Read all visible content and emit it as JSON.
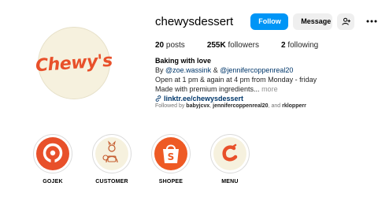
{
  "profile": {
    "username": "chewysdessert",
    "avatar_logo_text": "Chewy's"
  },
  "actions": {
    "follow_label": "Follow",
    "message_label": "Message",
    "suggest_icon": "add-user-icon",
    "more_icon": "more-icon"
  },
  "stats": {
    "posts_count": "20",
    "posts_label": "posts",
    "followers_count": "255K",
    "followers_label": "followers",
    "following_count": "2",
    "following_label": "following"
  },
  "bio": {
    "name": "Baking with love",
    "by_prefix": "By ",
    "mention_1": "@zoe.wassink",
    "amp": " & ",
    "mention_2": "@jennifercoppenreal20",
    "line_hours": "Open at 1 pm & again at 4 pm from Monday - friday",
    "line_ingredients": "Made with premium ingredients...",
    "more_label": " more",
    "link": "linktr.ee/chewysdessert"
  },
  "followed_by": {
    "prefix": "Followed by ",
    "user_1": "babyjcvx",
    "sep": ", ",
    "user_2": "jennifercoppenreal20",
    "and": ", and ",
    "user_3": "rklopperr"
  },
  "highlights": [
    {
      "label": "GOJEK",
      "icon": "gojek-icon"
    },
    {
      "label": "CUSTOMER",
      "icon": "customer-icon"
    },
    {
      "label": "SHOPEE",
      "icon": "shopee-bag-icon"
    },
    {
      "label": "MENU",
      "icon": "chewys-c-icon"
    }
  ],
  "colors": {
    "follow_blue": "#0095f6",
    "brand_orange": "#e8502a",
    "cream": "#f6f1de"
  }
}
